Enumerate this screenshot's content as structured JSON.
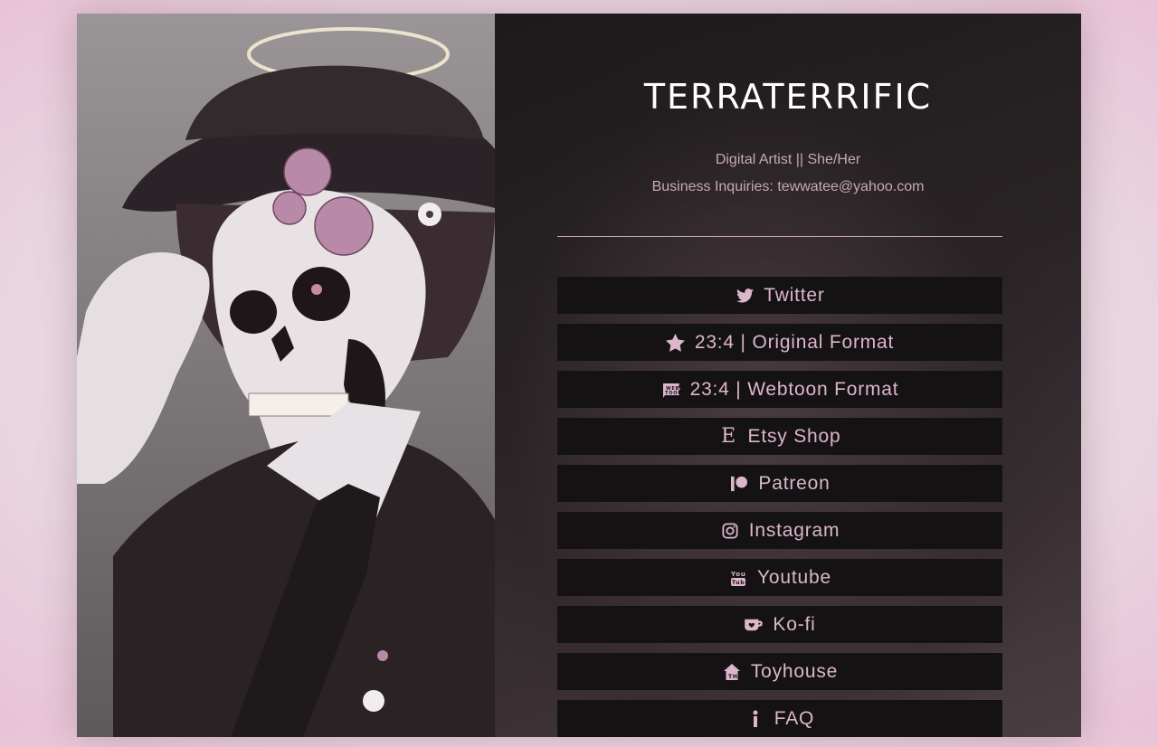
{
  "profile": {
    "name": "TERRATERRIFIC",
    "tagline": "Digital Artist || She/Her",
    "business": "Business Inquiries: tewwatee@yahoo.com"
  },
  "links": [
    {
      "label": "Twitter",
      "icon": "twitter-icon"
    },
    {
      "label": "23:4 | Original Format",
      "icon": "star-icon"
    },
    {
      "label": "23:4 | Webtoon Format",
      "icon": "webtoon-icon"
    },
    {
      "label": "Etsy Shop",
      "icon": "etsy-icon"
    },
    {
      "label": "Patreon",
      "icon": "patreon-icon"
    },
    {
      "label": "Instagram",
      "icon": "instagram-icon"
    },
    {
      "label": "Youtube",
      "icon": "youtube-icon"
    },
    {
      "label": "Ko-fi",
      "icon": "kofi-icon"
    },
    {
      "label": "Toyhouse",
      "icon": "toyhouse-icon"
    },
    {
      "label": "FAQ",
      "icon": "info-icon"
    }
  ],
  "colors": {
    "accent": "#dcb6cb",
    "button_bg": "#151214",
    "title": "#ffffff"
  }
}
